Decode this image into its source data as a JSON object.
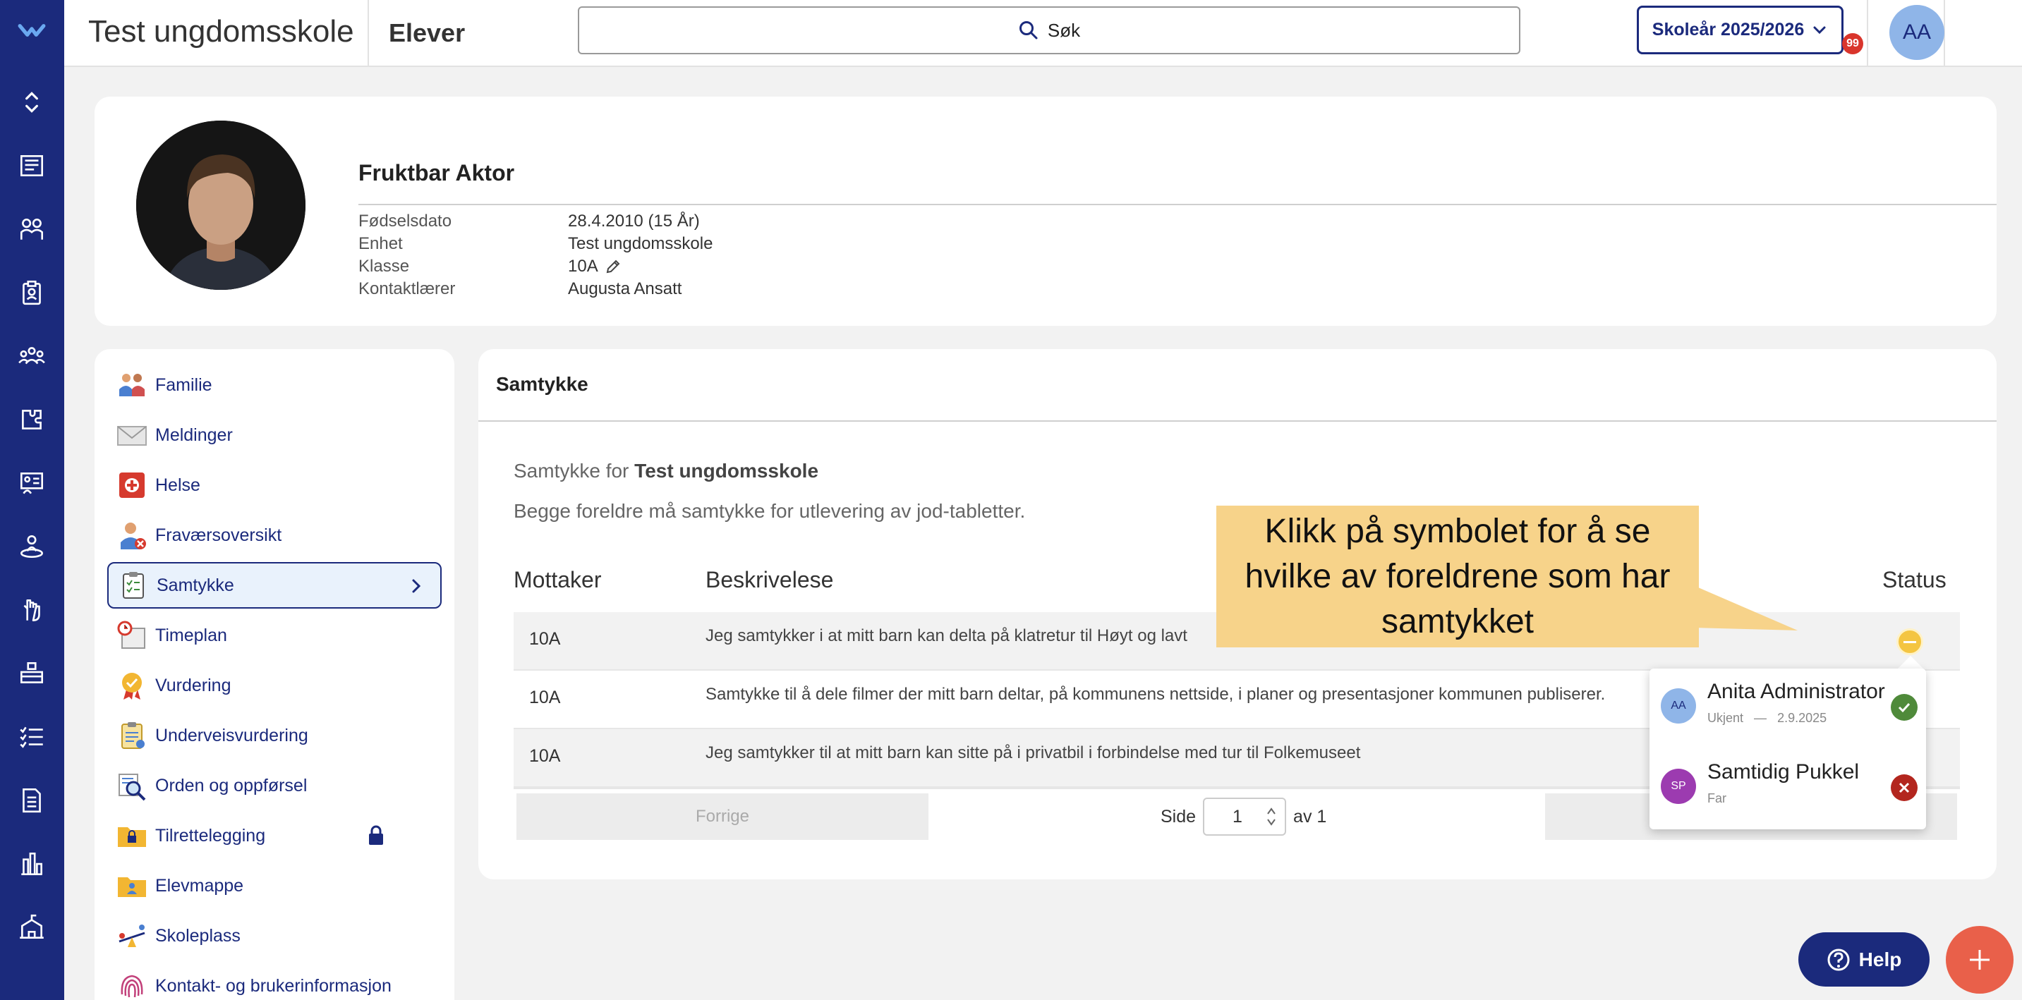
{
  "app": {
    "school_name": "Test ungdomsskole",
    "page_title": "Elever",
    "search_label": "Søk",
    "school_year": "Skoleår 2025/2026",
    "notification_count": "99",
    "user_initials": "AA"
  },
  "rail_icons": [
    "logo-icon",
    "expand-collapse-icon",
    "newspaper-icon",
    "students-icon",
    "badge-icon",
    "groups-icon",
    "puzzle-icon",
    "chalkboard-icon",
    "person-ring-icon",
    "hand-icon",
    "desk-icon",
    "checklist-icon",
    "document-icon",
    "bar-chart-icon",
    "school-icon"
  ],
  "student": {
    "name": "Fruktbar Aktor",
    "fields": [
      {
        "label": "Fødselsdato",
        "value": "28.4.2010 (15 År)"
      },
      {
        "label": "Enhet",
        "value": "Test ungdomsskole"
      },
      {
        "label": "Klasse",
        "value": "10A"
      },
      {
        "label": "Kontaktlærer",
        "value": "Augusta Ansatt"
      }
    ]
  },
  "menu": {
    "items": [
      {
        "label": "Familie",
        "icon": "family-icon"
      },
      {
        "label": "Meldinger",
        "icon": "envelope-icon"
      },
      {
        "label": "Helse",
        "icon": "health-icon"
      },
      {
        "label": "Fraværsoversikt",
        "icon": "absence-icon"
      },
      {
        "label": "Samtykke",
        "icon": "clipboard-icon",
        "active": true
      },
      {
        "label": "Timeplan",
        "icon": "schedule-icon"
      },
      {
        "label": "Vurdering",
        "icon": "medal-icon"
      },
      {
        "label": "Underveisvurdering",
        "icon": "clipboard-check-icon"
      },
      {
        "label": "Orden og oppførsel",
        "icon": "magnifier-icon"
      },
      {
        "label": "Tilrettelegging",
        "icon": "folder-lock-icon",
        "locked": true
      },
      {
        "label": "Elevmappe",
        "icon": "folder-person-icon"
      },
      {
        "label": "Skoleplass",
        "icon": "seesaw-icon"
      },
      {
        "label": "Kontakt- og brukerinformasjon",
        "icon": "fingerprint-icon"
      }
    ]
  },
  "consent": {
    "section_title": "Samtykke",
    "for_prefix": "Samtykke for",
    "for_school": "Test ungdomsskole",
    "description": "Begge foreldre må samtykke for utlevering av jod-tabletter.",
    "columns": [
      "Mottaker",
      "Beskrivelese",
      "Status"
    ],
    "rows": [
      {
        "recipient": "10A",
        "description": "Jeg samtykker i at mitt barn kan delta på klatretur til Høyt og lavt"
      },
      {
        "recipient": "10A",
        "description": "Samtykke til å dele filmer der mitt barn deltar, på kommunens nettside, i planer og presentasjoner kommunen publiserer."
      },
      {
        "recipient": "10A",
        "description": "Jeg samtykker til at mitt barn kan sitte på i privatbil i forbindelse med tur til Folkemuseet"
      }
    ],
    "pager": {
      "prev_label": "Forrige",
      "page_label": "Side",
      "page_value": "1",
      "of_label": "av 1"
    }
  },
  "callout": {
    "text": "Klikk på symbolet for å se hvilke av foreldrene som har samtykket",
    "color": "#f7d38a"
  },
  "popover": {
    "parents": [
      {
        "initials": "AA",
        "name": "Anita Administrator",
        "role": "Ukjent",
        "date": "2.9.2025",
        "status": "approved",
        "avatar_color": "#8fb5e8"
      },
      {
        "initials": "SP",
        "name": "Samtidig Pukkel",
        "role": "Far",
        "date": "",
        "status": "rejected",
        "avatar_color": "#9c3bb0"
      }
    ]
  },
  "help_label": "Help",
  "colors": {
    "brand": "#1b2a7c",
    "pending": "#f4c542",
    "approved": "#4f8a3a",
    "rejected": "#b3261e",
    "fab": "#e9604a"
  }
}
